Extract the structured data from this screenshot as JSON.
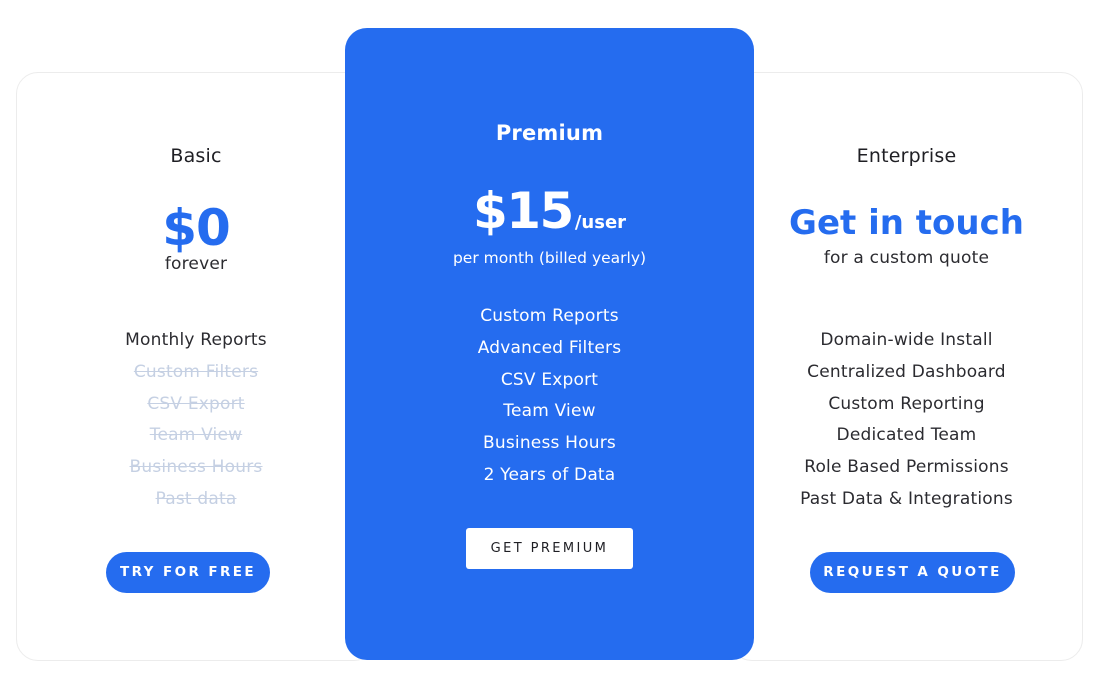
{
  "colors": {
    "accent": "#256cef",
    "text": "#2b2b30",
    "disabled_text": "#c5d0e3",
    "card_border": "#ececec"
  },
  "plans": {
    "basic": {
      "name": "Basic",
      "price": "$0",
      "price_note": "forever",
      "features": [
        {
          "label": "Monthly Reports",
          "included": true
        },
        {
          "label": "Custom Filters",
          "included": false
        },
        {
          "label": "CSV Export",
          "included": false
        },
        {
          "label": "Team View",
          "included": false
        },
        {
          "label": "Business Hours",
          "included": false
        },
        {
          "label": "Past data",
          "included": false
        }
      ],
      "cta": "TRY FOR FREE"
    },
    "premium": {
      "name": "Premium",
      "price": "$15",
      "price_unit": "/user",
      "billing": "per month (billed yearly)",
      "features": [
        {
          "label": "Custom Reports",
          "included": true
        },
        {
          "label": "Advanced Filters",
          "included": true
        },
        {
          "label": "CSV Export",
          "included": true
        },
        {
          "label": "Team View",
          "included": true
        },
        {
          "label": "Business Hours",
          "included": true
        },
        {
          "label": "2 Years of Data",
          "included": true
        }
      ],
      "cta": "GET PREMIUM",
      "highlighted": true
    },
    "enterprise": {
      "name": "Enterprise",
      "price": "Get in touch",
      "price_note": "for a custom quote",
      "features": [
        {
          "label": "Domain-wide Install",
          "included": true
        },
        {
          "label": "Centralized Dashboard",
          "included": true
        },
        {
          "label": "Custom Reporting",
          "included": true
        },
        {
          "label": "Dedicated Team",
          "included": true
        },
        {
          "label": "Role Based Permissions",
          "included": true
        },
        {
          "label": "Past Data & Integrations",
          "included": true
        }
      ],
      "cta": "REQUEST A QUOTE"
    }
  }
}
